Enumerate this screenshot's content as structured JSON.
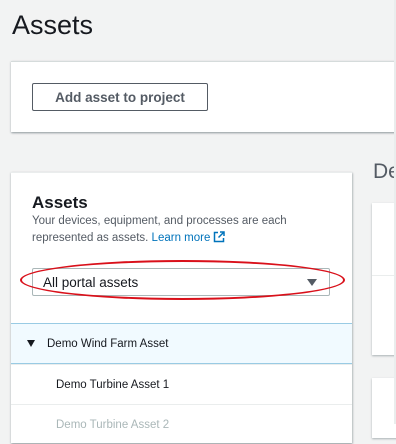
{
  "page": {
    "title": "Assets"
  },
  "toolbar": {
    "add_button_label": "Add asset to project"
  },
  "right_panel": {
    "heading_fragment": "De"
  },
  "assets_panel": {
    "title": "Assets",
    "description": "Your devices, equipment, and processes are each represented as assets.",
    "learn_more_label": "Learn more",
    "filter": {
      "selected": "All portal assets"
    }
  },
  "tree": {
    "items": [
      {
        "label": "Demo Wind Farm Asset",
        "expanded": true,
        "selected": true
      },
      {
        "label": "Demo Turbine Asset 1"
      },
      {
        "label": "Demo Turbine Asset 2"
      }
    ]
  },
  "colors": {
    "link": "#0073bb",
    "highlight_ring": "#d9101a",
    "selected_row": "#f1faff"
  },
  "icons": [
    "external-link-icon",
    "caret-down-icon",
    "tree-expanded-icon"
  ]
}
